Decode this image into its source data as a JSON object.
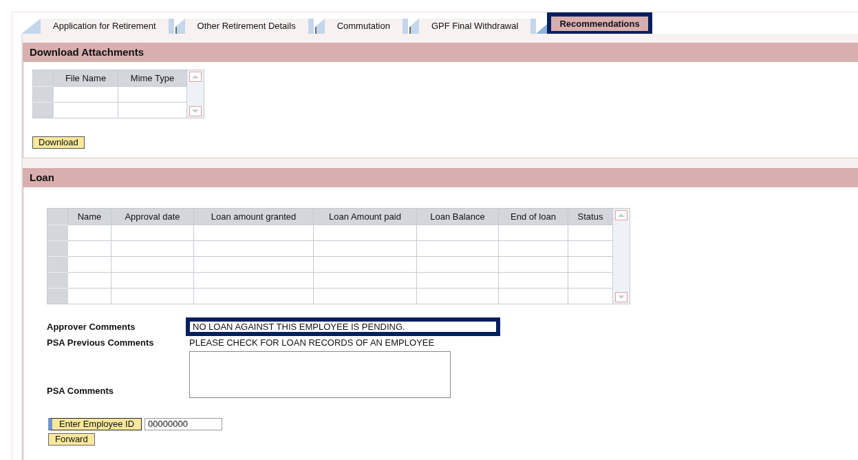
{
  "tabs": [
    {
      "label": "Application for Retirement",
      "selected": false
    },
    {
      "label": "Other Retirement Details",
      "selected": false
    },
    {
      "label": "Commutation",
      "selected": false
    },
    {
      "label": "GPF Final Withdrawal",
      "selected": false
    },
    {
      "label": "Recommendations",
      "selected": true
    }
  ],
  "attachments": {
    "title": "Download Attachments",
    "columns": [
      "File Name",
      "Mime Type"
    ],
    "button": "Download"
  },
  "loan": {
    "title": "Loan",
    "columns": [
      "Name",
      "Approval date",
      "Loan amount granted",
      "Loan Amount paid",
      "Loan Balance",
      "End of loan",
      "Status"
    ],
    "approver_comments": {
      "label": "Approver Comments",
      "value": "NO LOAN AGAINST THIS EMPLOYEE IS PENDING.",
      "highlighted": true
    },
    "psa_previous_comments": {
      "label": "PSA Previous Comments",
      "value": "PLEASE CHECK FOR LOAN RECORDS OF AN EMPLOYEE"
    },
    "psa_comments": {
      "label": "PSA Comments"
    },
    "employee_id": {
      "button": "Enter Employee ID",
      "value": "00000000"
    },
    "forward_button": "Forward"
  }
}
